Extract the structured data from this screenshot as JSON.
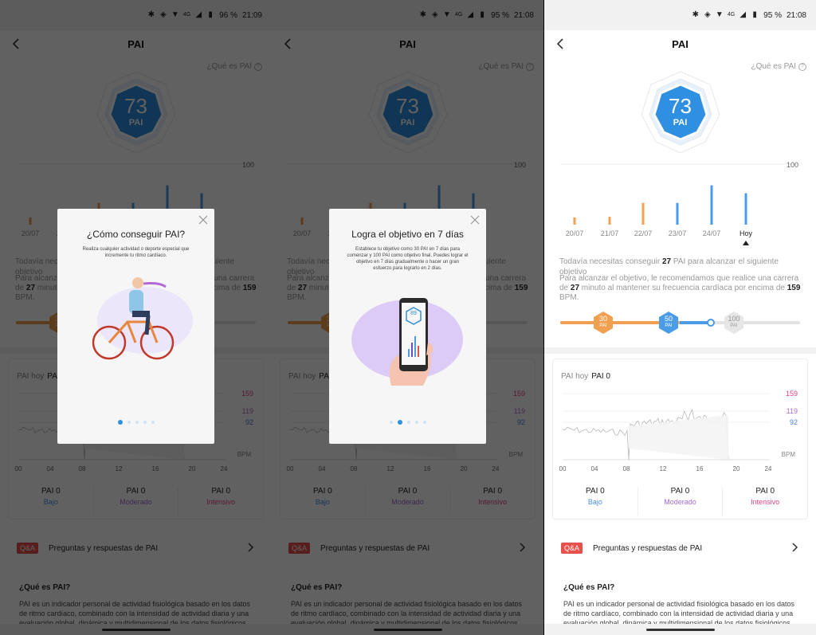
{
  "panels": [
    {
      "status": {
        "battery": "96 %",
        "time": "21:09",
        "network": "4G"
      },
      "modal": {
        "title": "¿Cómo conseguir PAI?",
        "body": "Realiza cualquier actividad o deporte especial que incremente tu ritmo cardíaco.",
        "active_dot": 0,
        "dot_count": 5
      }
    },
    {
      "status": {
        "battery": "95 %",
        "time": "21:08",
        "network": "4G"
      },
      "modal": {
        "title": "Logra el objetivo en 7 días",
        "body": "Establece tu objetivo como 30 PAI en 7 días para comenzar y 100 PAI como objetivo final. Puedes lograr el objetivo en 7 días gradualmente o hacer un gran esfuerzo para lograrlo en 2 días.",
        "phone_value": "89",
        "active_dot": 1,
        "dot_count": 5
      }
    },
    {
      "status": {
        "battery": "95 %",
        "time": "21:08",
        "network": "4G"
      }
    }
  ],
  "page": {
    "title": "PAI",
    "whatis_link": "¿Qué es PAI",
    "pai_value": "73",
    "pai_unit": "PAI",
    "msg_prefix": "Todavía necesitas conseguir ",
    "msg_amount": "27",
    "msg_suffix": " PAI para alcanzar el siguiente objetivo",
    "rec_prefix": "Para alcanzar el objetivo, le recomendamos que realice una carrera de ",
    "rec_minutes": "27",
    "rec_middle": " minuto al mantener su frecuencia cardíaca por encima de ",
    "rec_bpm": "159",
    "rec_suffix": " BPM."
  },
  "goals": [
    {
      "value": "30",
      "unit": "PAI",
      "color": "#f0a050"
    },
    {
      "value": "50",
      "unit": "PAI",
      "color": "#4b9ce8"
    },
    {
      "value": "100",
      "unit": "PAI",
      "color": "#e6e6e6"
    }
  ],
  "goal_progress": 73,
  "day_card": {
    "label": "PAI hoy",
    "value": "PAI 0",
    "ref_lines": [
      {
        "label": "159",
        "color": "#e3418a"
      },
      {
        "label": "119",
        "color": "#b36ad6"
      },
      {
        "label": "92",
        "color": "#4a7fd6"
      }
    ],
    "unit": "BPM",
    "x_ticks": [
      "00",
      "04",
      "08",
      "12",
      "16",
      "20",
      "24"
    ],
    "zones": [
      {
        "value": "PAI 0",
        "name": "Bajo",
        "color": "#4a90e2"
      },
      {
        "value": "PAI 0",
        "name": "Moderado",
        "color": "#a66bd6"
      },
      {
        "value": "PAI 0",
        "name": "Intensivo",
        "color": "#e3418a"
      }
    ]
  },
  "qa": {
    "badge": "Q&A",
    "label": "Preguntas y respuestas de PAI"
  },
  "info": {
    "title": "¿Qué es PAI?",
    "text": "PAI es un indicador personal de actividad fisiológica basado en los datos de ritmo cardíaco, combinado con la intensidad de actividad diaria y una evaluación global, dinámica y multidimensional de los datos fisiológicos"
  },
  "chart_data": {
    "type": "bar",
    "categories": [
      "20/07",
      "21/07",
      "22/07",
      "23/07",
      "24/07",
      "Hoy"
    ],
    "values": [
      12,
      13,
      36,
      36,
      65,
      52
    ],
    "colors": [
      "#f0a050",
      "#f0a050",
      "#f0a050",
      "#4b9ce8",
      "#4b9ce8",
      "#4b9ce8"
    ],
    "ylim": [
      0,
      100
    ],
    "ytick_top": "100"
  }
}
